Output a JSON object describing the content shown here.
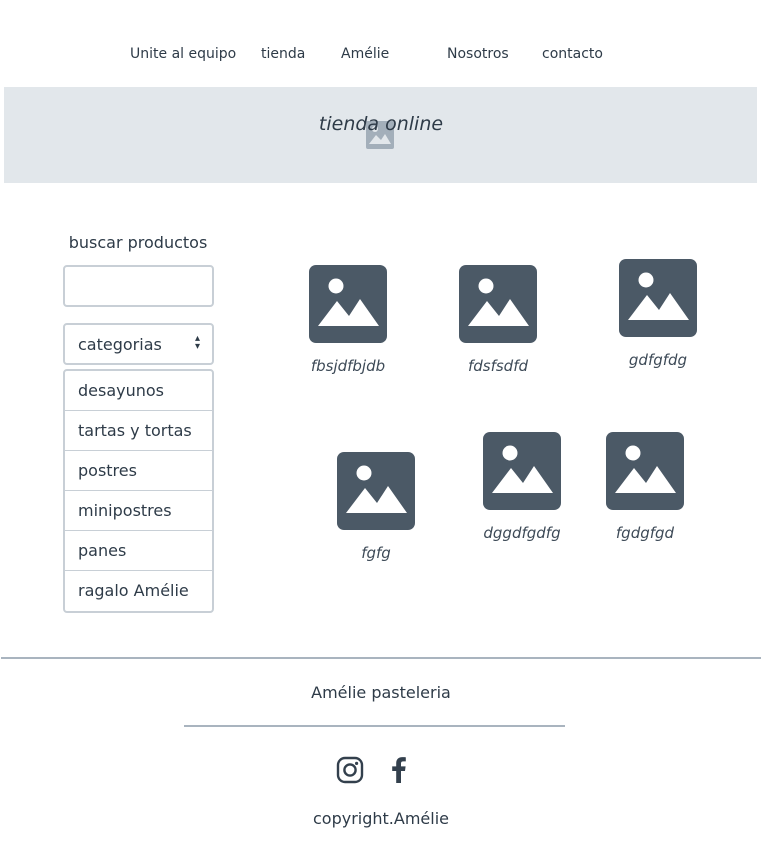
{
  "nav": {
    "items": [
      "Unite al equipo",
      "tienda",
      "Amélie",
      "Nosotros",
      "contacto"
    ]
  },
  "hero": {
    "title": "tienda online",
    "icon": "image-placeholder-icon"
  },
  "sidebar": {
    "search_label": "buscar productos",
    "search_value": "",
    "category_select": "categorias",
    "categories": [
      "desayunos",
      "tartas y tortas",
      "postres",
      "minipostres",
      "panes",
      "ragalo Amélie"
    ]
  },
  "products": [
    {
      "name": "fbsjdfbjdb",
      "icon": "image-placeholder-icon"
    },
    {
      "name": "fdsfsdfd",
      "icon": "image-placeholder-icon"
    },
    {
      "name": "gdfgfdg",
      "icon": "image-placeholder-icon"
    },
    {
      "name": "fgfg",
      "icon": "image-placeholder-icon"
    },
    {
      "name": "dggdfgdfg",
      "icon": "image-placeholder-icon"
    },
    {
      "name": "fgdgfgd",
      "icon": "image-placeholder-icon"
    }
  ],
  "footer": {
    "title": "Amélie pasteleria",
    "social": [
      "instagram-icon",
      "facebook-icon"
    ],
    "copyright": "copyright.Amélie"
  },
  "colors": {
    "icon": "#4b5966",
    "hero_bg": "#e2e7eb",
    "border": "#c8cfd6",
    "divider": "#a9b4bf"
  }
}
